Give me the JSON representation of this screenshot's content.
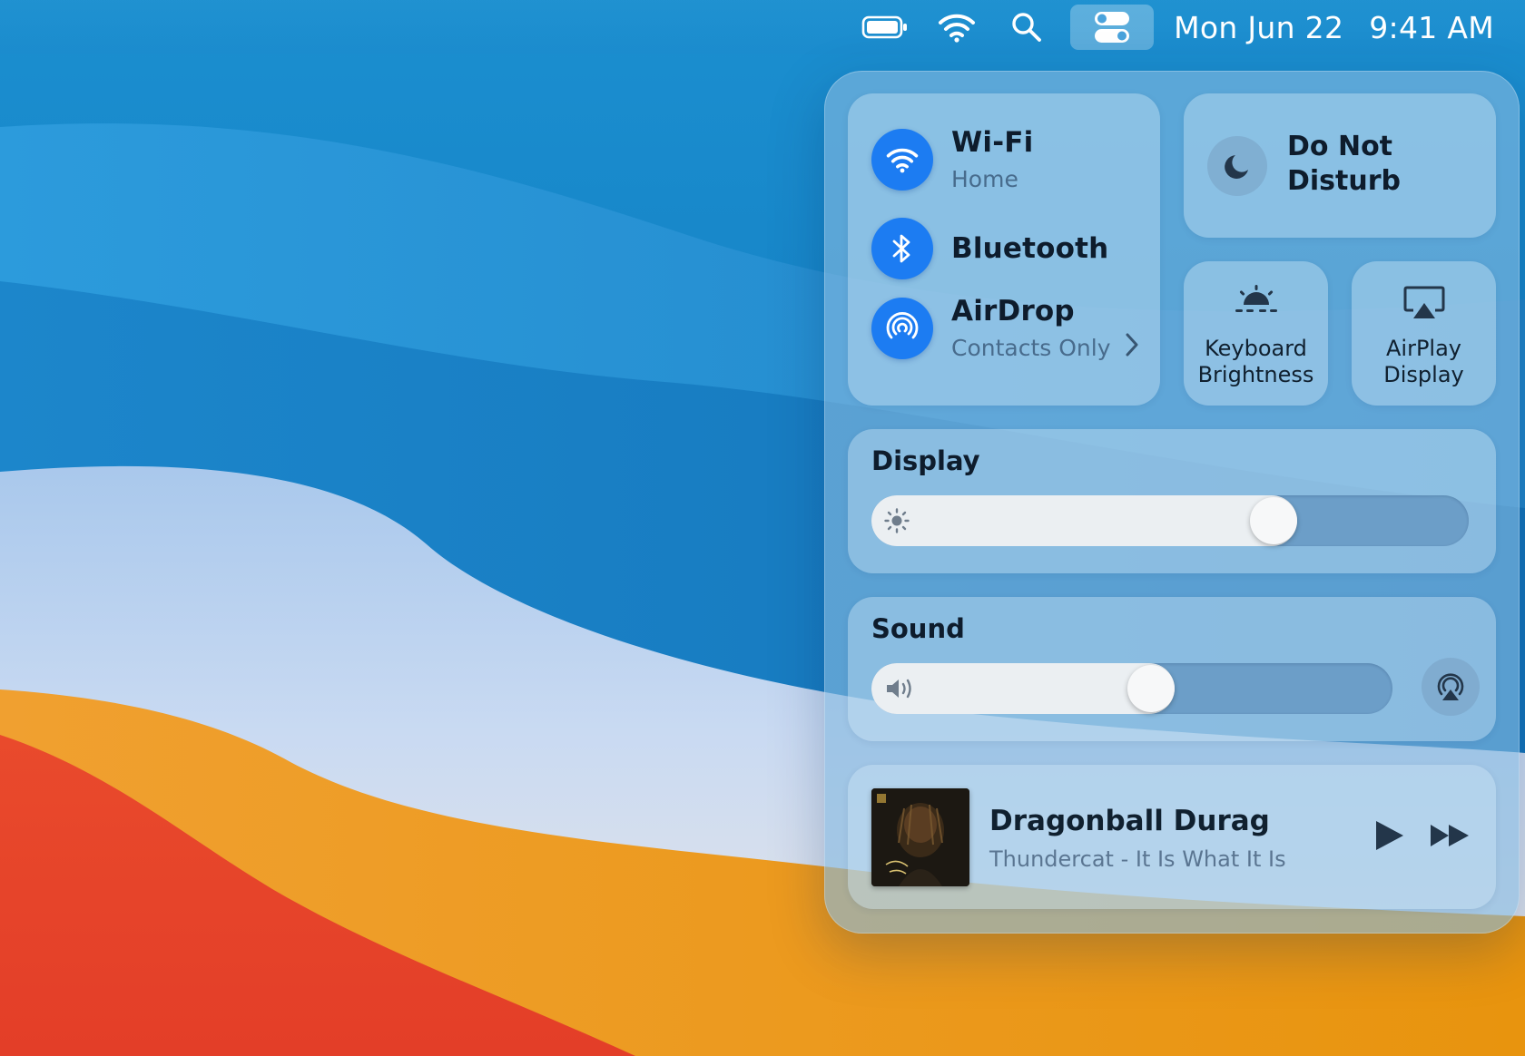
{
  "menubar": {
    "date": "Mon Jun 22",
    "time": "9:41 AM",
    "icons": [
      "battery-icon",
      "wifi-icon",
      "search-icon",
      "control-center-icon"
    ]
  },
  "control_center": {
    "wifi": {
      "label": "Wi-Fi",
      "sub": "Home",
      "icon": "wifi-icon",
      "on": true
    },
    "bluetooth": {
      "label": "Bluetooth",
      "icon": "bluetooth-icon",
      "on": true
    },
    "airdrop": {
      "label": "AirDrop",
      "sub": "Contacts Only",
      "icon": "airdrop-icon",
      "on": true
    },
    "dnd": {
      "line1": "Do Not",
      "line2": "Disturb",
      "icon": "moon-icon",
      "on": false
    },
    "keyboard_brightness": {
      "line1": "Keyboard",
      "line2": "Brightness",
      "icon": "keyboard-brightness-icon"
    },
    "airplay_display": {
      "line1": "AirPlay",
      "line2": "Display",
      "icon": "airplay-display-icon"
    },
    "display": {
      "title": "Display",
      "brightness_fraction": 0.69,
      "icon": "sun-icon"
    },
    "sound": {
      "title": "Sound",
      "volume_fraction": 0.54,
      "icon": "speaker-icon",
      "output_icon": "airplay-audio-icon"
    },
    "now_playing": {
      "title": "Dragonball Durag",
      "subtitle": "Thundercat - It Is What It Is",
      "controls": [
        "play-icon",
        "fast-forward-icon"
      ]
    }
  },
  "colors": {
    "accent_blue": "#1c7cf2",
    "panel": "#84b8de",
    "slider_fill": "#ebeff2"
  }
}
